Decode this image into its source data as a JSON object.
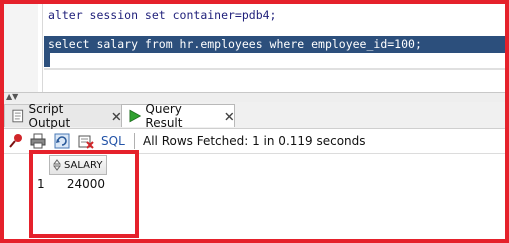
{
  "editor": {
    "line1": "alter session set container=pdb4;",
    "line2": "select salary from hr.employees where employee_id=100;"
  },
  "tabs": [
    {
      "label": "Script Output",
      "icon": "script-output-icon"
    },
    {
      "label": "Query Result",
      "icon": "run-query-icon"
    }
  ],
  "toolbar": {
    "sql_label": "SQL",
    "status": "All Rows Fetched: 1 in 0.119 seconds"
  },
  "result": {
    "columns": [
      "SALARY"
    ],
    "rows": [
      {
        "row_number": "1",
        "salary": "24000"
      }
    ]
  },
  "colors": {
    "highlight": "#e5212b",
    "selection": "#2c4f7c"
  }
}
